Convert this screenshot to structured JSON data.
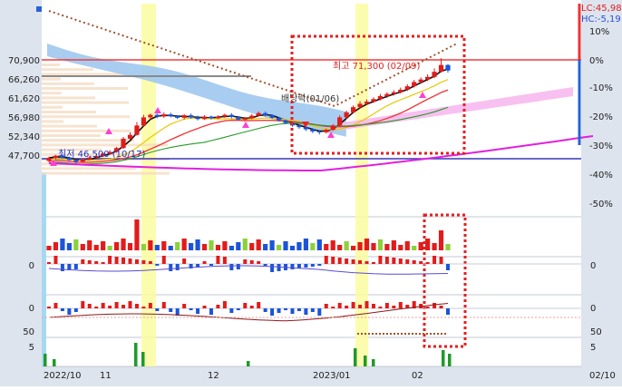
{
  "chart_data": {
    "type": "candlestick",
    "price_axis_left": [
      "70,900",
      "66,260",
      "61,620",
      "56,980",
      "52,340",
      "47,700"
    ],
    "pct_axis_right": [
      "10%",
      "0%",
      "-10%",
      "-20%",
      "-30%",
      "-40%",
      "-50%"
    ],
    "corner_labels": {
      "lc": "LC:45,98",
      "hc": "HC:-5,19"
    },
    "x_axis": [
      "2022/10",
      "11",
      "12",
      "2023/01",
      "02",
      "02/10"
    ],
    "annotations": {
      "high": "최고 71,300 (02/09)",
      "low": "최저 46,500 (10/17)",
      "dividend": "배당락(01/06)"
    },
    "lower_panel_labels": {
      "left": [
        "0",
        "0",
        "50",
        "5"
      ],
      "right": [
        "0",
        "0",
        "50",
        "5"
      ]
    },
    "candles": [
      [
        47.2,
        47.9,
        46.9,
        48.2
      ],
      [
        47.9,
        48.4,
        47.6,
        48.6
      ],
      [
        48.4,
        48.0,
        47.7,
        48.7
      ],
      [
        48.0,
        47.4,
        47.2,
        48.2
      ],
      [
        47.4,
        47.0,
        46.5,
        47.6
      ],
      [
        47.0,
        47.5,
        46.8,
        47.8
      ],
      [
        47.5,
        48.0,
        47.3,
        48.3
      ],
      [
        48.0,
        48.3,
        47.8,
        48.6
      ],
      [
        48.3,
        48.9,
        48.1,
        49.2
      ],
      [
        48.9,
        49.3,
        48.7,
        49.7
      ],
      [
        49.3,
        50.2,
        49.1,
        50.5
      ],
      [
        50.2,
        52.4,
        50.0,
        52.8
      ],
      [
        52.4,
        53.3,
        52.1,
        53.9
      ],
      [
        53.3,
        55.5,
        53.1,
        56.3
      ],
      [
        55.5,
        57.4,
        55.2,
        58.0
      ],
      [
        57.4,
        58.0,
        56.9,
        58.3
      ],
      [
        58.0,
        57.6,
        57.2,
        58.3
      ],
      [
        57.6,
        58.1,
        57.3,
        58.6
      ],
      [
        58.1,
        57.7,
        57.4,
        58.5
      ],
      [
        57.7,
        57.3,
        57.0,
        57.9
      ],
      [
        57.3,
        57.9,
        56.9,
        58.2
      ],
      [
        57.9,
        57.4,
        57.1,
        58.3
      ],
      [
        57.4,
        57.0,
        56.7,
        57.8
      ],
      [
        57.0,
        57.6,
        56.8,
        57.9
      ],
      [
        57.6,
        57.2,
        56.9,
        57.8
      ],
      [
        57.2,
        57.6,
        57.0,
        57.9
      ],
      [
        57.6,
        58.0,
        57.3,
        58.3
      ],
      [
        58.0,
        57.5,
        57.2,
        58.4
      ],
      [
        57.5,
        56.9,
        56.6,
        57.7
      ],
      [
        56.9,
        57.2,
        56.6,
        57.5
      ],
      [
        57.2,
        57.8,
        57.0,
        58.2
      ],
      [
        57.8,
        58.4,
        57.6,
        58.8
      ],
      [
        58.4,
        57.9,
        57.6,
        58.8
      ],
      [
        57.9,
        57.3,
        57.0,
        58.1
      ],
      [
        57.3,
        56.7,
        56.4,
        57.5
      ],
      [
        56.7,
        56.1,
        55.8,
        56.9
      ],
      [
        56.1,
        55.5,
        55.2,
        56.3
      ],
      [
        55.5,
        55.1,
        54.7,
        55.7
      ],
      [
        55.1,
        54.6,
        54.2,
        55.4
      ],
      [
        54.6,
        54.1,
        53.7,
        54.9
      ],
      [
        54.1,
        53.9,
        53.4,
        54.4
      ],
      [
        53.9,
        54.5,
        53.6,
        54.8
      ],
      [
        54.5,
        55.5,
        54.2,
        55.8
      ],
      [
        55.5,
        57.4,
        55.2,
        57.9
      ],
      [
        57.4,
        58.6,
        57.1,
        59.0
      ],
      [
        58.6,
        59.8,
        58.3,
        60.2
      ],
      [
        59.8,
        60.6,
        59.5,
        61.2
      ],
      [
        60.6,
        61.1,
        60.3,
        61.6
      ],
      [
        61.1,
        61.7,
        60.8,
        62.1
      ],
      [
        61.7,
        62.4,
        61.4,
        62.9
      ],
      [
        62.4,
        62.9,
        62.0,
        63.3
      ],
      [
        62.9,
        63.3,
        62.5,
        63.8
      ],
      [
        63.3,
        63.9,
        63.0,
        64.4
      ],
      [
        63.9,
        64.7,
        63.6,
        65.2
      ],
      [
        64.7,
        65.7,
        64.4,
        66.2
      ],
      [
        65.7,
        66.3,
        65.3,
        66.8
      ],
      [
        66.3,
        66.9,
        65.9,
        67.5
      ],
      [
        66.9,
        68.1,
        66.6,
        68.9
      ],
      [
        68.1,
        69.7,
        67.9,
        71.3
      ],
      [
        69.7,
        68.4,
        67.9,
        69.9
      ]
    ]
  }
}
